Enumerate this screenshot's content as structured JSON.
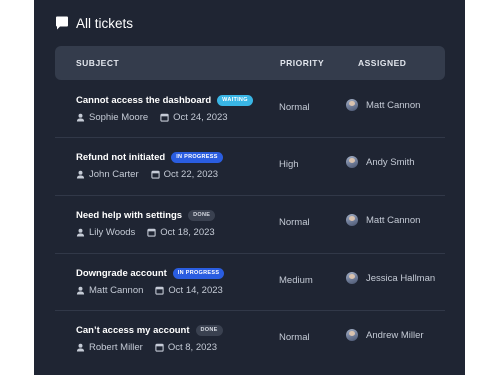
{
  "header": {
    "title": "All tickets",
    "icon": "chat-bubble-icon"
  },
  "columns": {
    "subject": "SUBJECT",
    "priority": "PRIORITY",
    "assigned": "ASSIGNED"
  },
  "colors": {
    "panel_bg": "#1f2533",
    "header_row_bg": "#343c4c",
    "badge_waiting": "#39b6e6",
    "badge_in_progress": "#2a5de0",
    "badge_done": "#3a4150"
  },
  "tickets": [
    {
      "subject": "Cannot access the dashboard",
      "status": "WAITING",
      "status_kind": "waiting",
      "requester": "Sophie Moore",
      "date": "Oct 24, 2023",
      "priority": "Normal",
      "assignee": "Matt Cannon"
    },
    {
      "subject": "Refund not initiated",
      "status": "IN PROGRESS",
      "status_kind": "progress",
      "requester": "John Carter",
      "date": "Oct 22, 2023",
      "priority": "High",
      "assignee": "Andy Smith"
    },
    {
      "subject": "Need help with settings",
      "status": "DONE",
      "status_kind": "done",
      "requester": "Lily Woods",
      "date": "Oct 18, 2023",
      "priority": "Normal",
      "assignee": "Matt Cannon"
    },
    {
      "subject": "Downgrade account",
      "status": "IN PROGRESS",
      "status_kind": "progress",
      "requester": "Matt Cannon",
      "date": "Oct 14, 2023",
      "priority": "Medium",
      "assignee": "Jessica Hallman"
    },
    {
      "subject": "Can’t access my account",
      "status": "DONE",
      "status_kind": "done",
      "requester": "Robert Miller",
      "date": "Oct 8, 2023",
      "priority": "Normal",
      "assignee": "Andrew Miller"
    }
  ]
}
